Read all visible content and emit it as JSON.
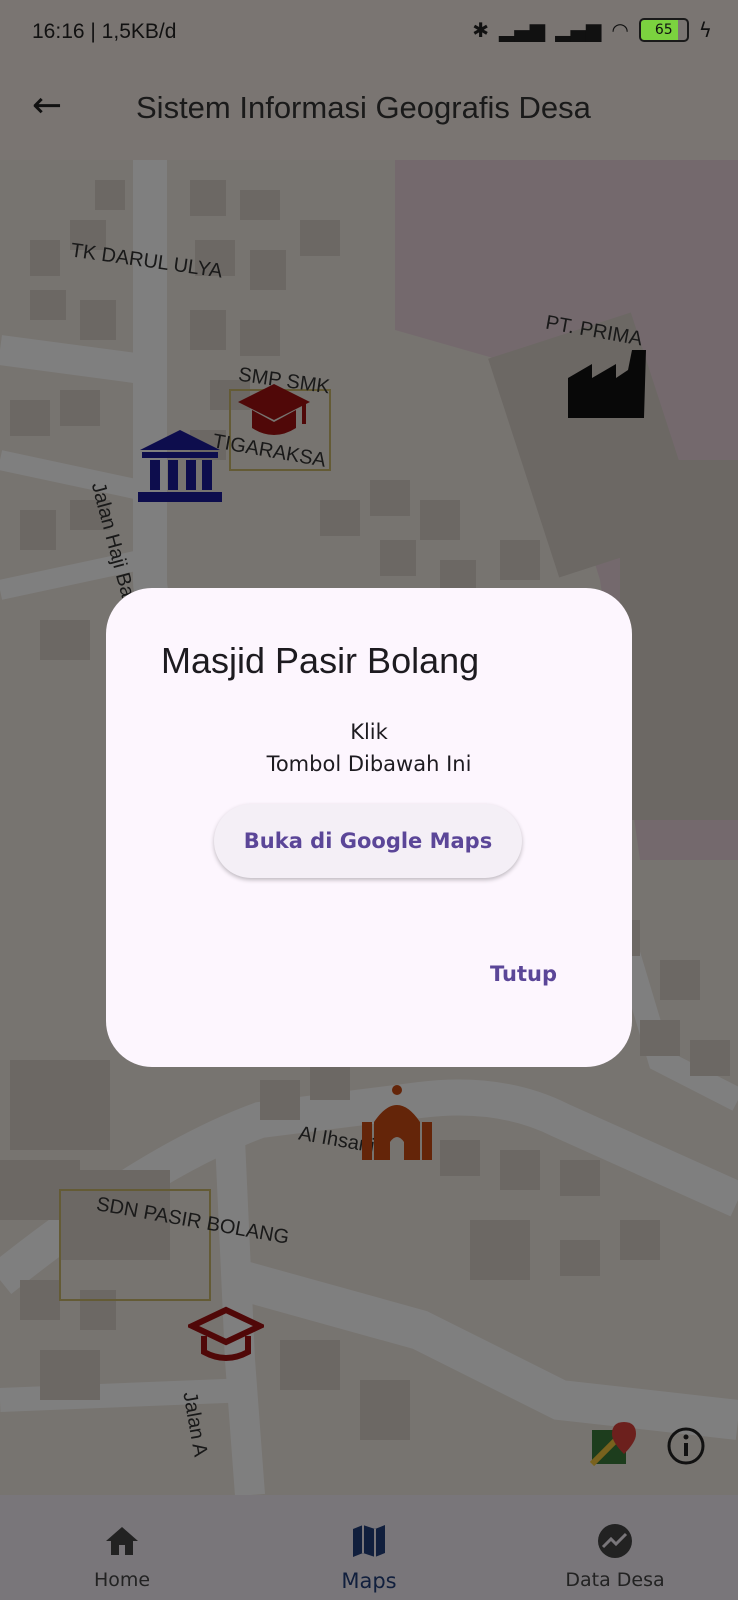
{
  "status_bar": {
    "time": "16:16 | 1,5KB/d",
    "battery": "65"
  },
  "app_bar": {
    "title": "Sistem Informasi Geografis Desa"
  },
  "map": {
    "labels": {
      "tk": "TK DARUL ULYA",
      "smp": "SMP SMK",
      "tigaraksa": "TIGARAKSA",
      "pt": "PT. PRIMA",
      "jalan_haji": "Jalan Haji Basar",
      "masjid_al": "Al Ihsania",
      "sdn": "SDN PASIR BOLANG",
      "jalan_bottom": "Jalan A"
    }
  },
  "dialog": {
    "title": "Masjid Pasir Bolang",
    "line1": "Klik",
    "line2": "Tombol Dibawah Ini",
    "open_button": "Buka di Google Maps",
    "close_button": "Tutup"
  },
  "bottom_nav": {
    "items": [
      {
        "label": "Home",
        "icon": "home-icon"
      },
      {
        "label": "Maps",
        "icon": "map-icon"
      },
      {
        "label": "Data Desa",
        "icon": "chart-icon"
      }
    ],
    "active": "Maps"
  },
  "colors": {
    "primary": "#5b4698",
    "nav_active": "#233f7a",
    "school_marker": "#a01010",
    "office_marker": "#1a1a9a",
    "mosque_marker": "#c94a12"
  }
}
